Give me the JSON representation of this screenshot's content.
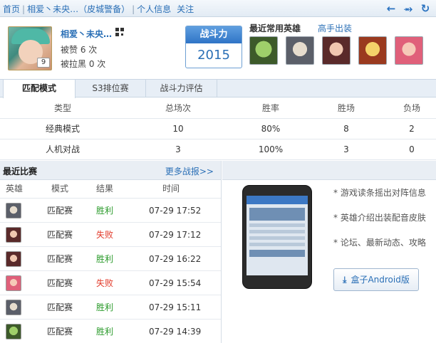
{
  "breadcrumb": {
    "home": "首页",
    "player": "相爱丶未央…（皮城警备）",
    "section": "个人信息",
    "follow": "关注"
  },
  "icons": {
    "back": "back-arrow-icon",
    "share": "share-icon",
    "refresh": "refresh-icon"
  },
  "profile": {
    "name": "相爱丶未央…",
    "level": "9",
    "likes": "被赞 6 次",
    "blacklisted": "被拉黑 0 次"
  },
  "power": {
    "label": "战斗力",
    "value": "2015"
  },
  "frequent": {
    "title": "最近常用英雄",
    "gear_link": "高手出装"
  },
  "tabs": [
    "匹配模式",
    "S3排位赛",
    "战斗力评估"
  ],
  "stats": {
    "headers": [
      "类型",
      "总场次",
      "胜率",
      "胜场",
      "负场"
    ],
    "rows": [
      [
        "经典模式",
        "10",
        "80%",
        "8",
        "2"
      ],
      [
        "人机对战",
        "3",
        "100%",
        "3",
        "0"
      ]
    ]
  },
  "recent": {
    "title": "最近比赛",
    "more": "更多战报>>",
    "headers": [
      "英雄",
      "模式",
      "结果",
      "时间"
    ],
    "rows": [
      {
        "mode": "匹配赛",
        "result": "胜利",
        "win": true,
        "time": "07-29 17:52"
      },
      {
        "mode": "匹配赛",
        "result": "失败",
        "win": false,
        "time": "07-29 17:12"
      },
      {
        "mode": "匹配赛",
        "result": "胜利",
        "win": true,
        "time": "07-29 16:22"
      },
      {
        "mode": "匹配赛",
        "result": "失败",
        "win": false,
        "time": "07-29 15:54"
      },
      {
        "mode": "匹配赛",
        "result": "胜利",
        "win": true,
        "time": "07-29 15:11"
      },
      {
        "mode": "匹配赛",
        "result": "胜利",
        "win": true,
        "time": "07-29 14:39"
      }
    ]
  },
  "promo": {
    "features": [
      "* 游戏读条摇出对阵信息",
      "* 英雄介绍出装配音皮肤",
      "* 论坛、最新动态、攻略"
    ],
    "download": "盒子Android版"
  },
  "colors": {
    "accent": "#2a6fb6",
    "win": "#2a9a2a",
    "lose": "#e23a2a"
  }
}
